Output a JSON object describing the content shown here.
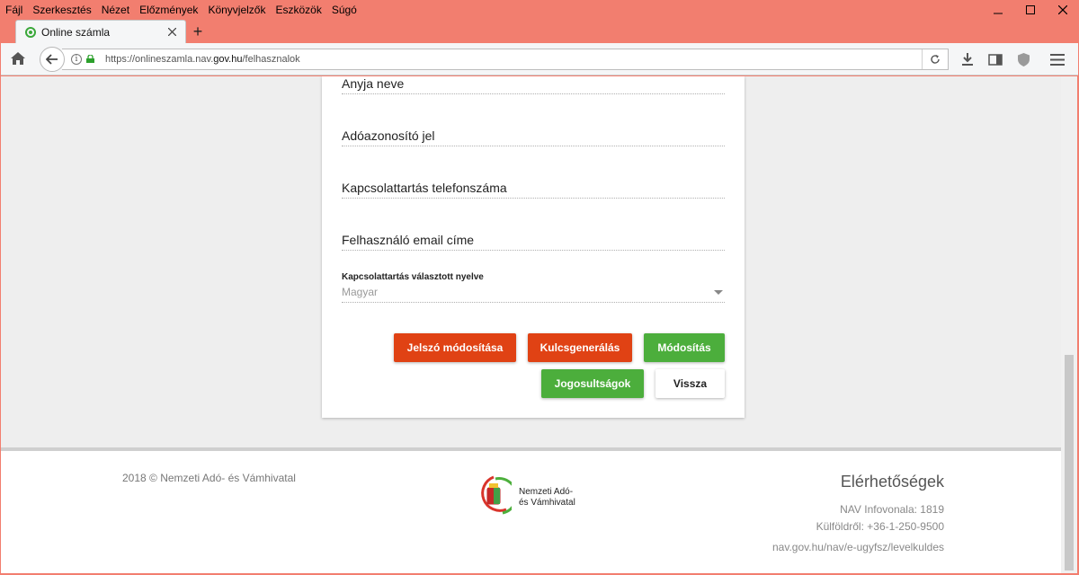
{
  "menu": [
    "Fájl",
    "Szerkesztés",
    "Nézet",
    "Előzmények",
    "Könyvjelzők",
    "Eszközök",
    "Súgó"
  ],
  "tab": {
    "title": "Online számla"
  },
  "url": {
    "prefix": "https://onlineszamla.nav.",
    "domain": "gov.hu",
    "path": "/felhasznalok"
  },
  "form": {
    "fields": [
      "Anyja neve",
      "Adóazonosító jel",
      "Kapcsolattartás telefonszáma",
      "Felhasználó email címe"
    ],
    "language_label": "Kapcsolattartás választott nyelve",
    "language_value": "Magyar"
  },
  "buttons": {
    "password": "Jelszó módosítása",
    "keygen": "Kulcsgenerálás",
    "modify": "Módosítás",
    "permissions": "Jogosultságok",
    "back": "Vissza"
  },
  "footer": {
    "copyright": "2018 © Nemzeti Adó- és Vámhivatal",
    "logo_line1": "Nemzeti Adó-",
    "logo_line2": "és Vámhivatal",
    "contact_title": "Elérhetőségek",
    "infoline": "NAV Infovonala: 1819",
    "abroad": "Külföldről: +36-1-250-9500",
    "link": "nav.gov.hu/nav/e-ugyfsz/levelkuldes"
  },
  "colors": {
    "frame": "#f27e6f",
    "red_button": "#e04214",
    "green_button": "#4cae3c"
  }
}
